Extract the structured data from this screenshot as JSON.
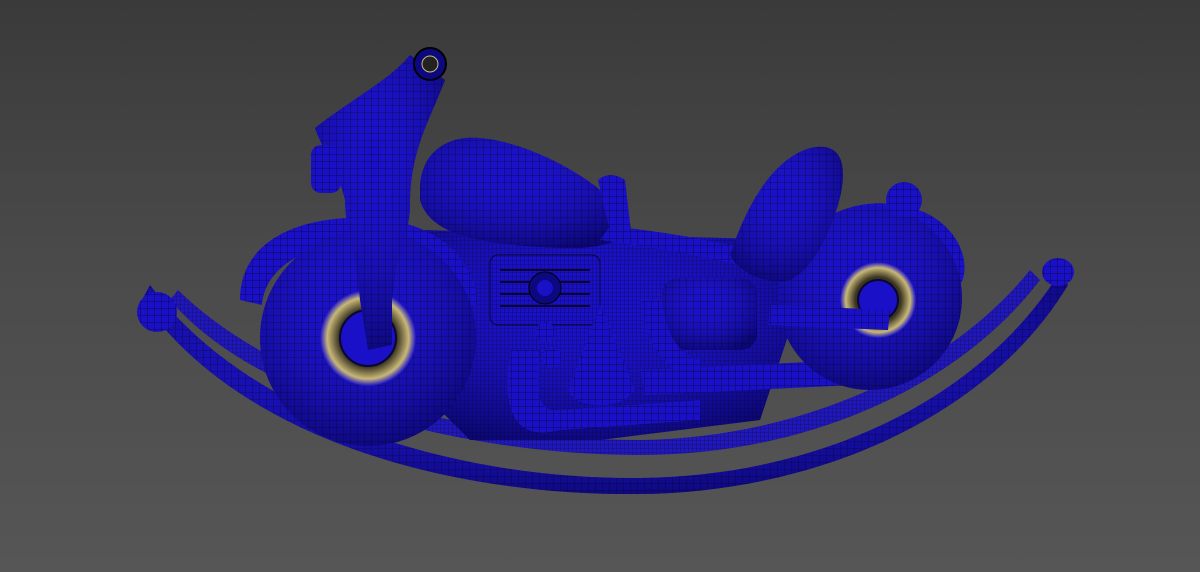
{
  "viewport": {
    "background_top": "#3a3a3a",
    "background_bottom": "#565656"
  },
  "model": {
    "subject": "rocking-horse-motorcycle-wireframe",
    "shade_color": "#1a10c8",
    "shade_dark": "#0c0880",
    "wire_color": "#0a0630",
    "wheel_hub_color": "#c8b878"
  }
}
